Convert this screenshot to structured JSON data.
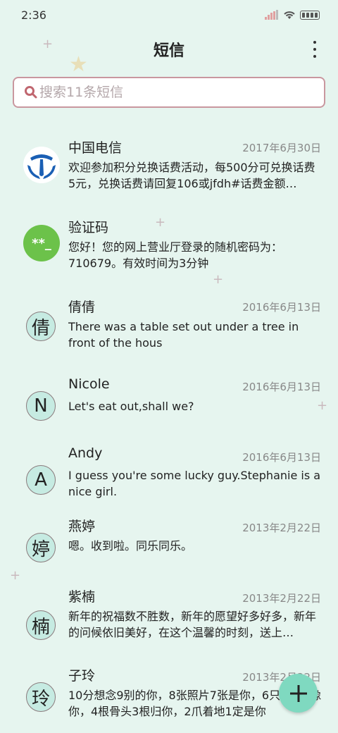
{
  "status": {
    "time": "2:36"
  },
  "header": {
    "title": "短信"
  },
  "search": {
    "placeholder": "搜索11条短信"
  },
  "conversations": [
    {
      "avatar_text": "",
      "avatar_type": "china-telecom-logo",
      "name": "中国电信",
      "date": "2017年6月30日",
      "preview": "欢迎参加积分兑换话费活动，每500分可兑换话费5元，兑换话费请回复106或jfdh#话费金额…"
    },
    {
      "avatar_text": "**_",
      "avatar_type": "code",
      "name": "验证码",
      "date": "",
      "preview": "您好！您的网上营业厅登录的随机密码为：710679。有效时间为3分钟"
    },
    {
      "avatar_text": "倩",
      "avatar_type": "letter",
      "name": "倩倩",
      "date": "2016年6月13日",
      "preview": "There was a table set out under a tree in front of the hous"
    },
    {
      "avatar_text": "N",
      "avatar_type": "letter",
      "name": "Nicole",
      "date": "2016年6月13日",
      "preview": "Let's eat out,shall we?"
    },
    {
      "avatar_text": "A",
      "avatar_type": "letter",
      "name": "Andy",
      "date": "2016年6月13日",
      "preview": "I guess you're some lucky guy.Stephanie is a nice girl."
    },
    {
      "avatar_text": "婷",
      "avatar_type": "letter",
      "name": "燕婷",
      "date": "2013年2月22日",
      "preview": "嗯。收到啦。同乐同乐。"
    },
    {
      "avatar_text": "楠",
      "avatar_type": "letter",
      "name": "紫楠",
      "date": "2013年2月22日",
      "preview": "新年的祝福数不胜数，新年的愿望好多好多，新年的问候依旧美好，在这个温馨的时刻，送上…"
    },
    {
      "avatar_text": "玲",
      "avatar_type": "letter",
      "name": "子玲",
      "date": "2013年2月22日",
      "preview": "10分想念9别的你，8张照片7张是你，6只猫5只像你，4根骨头3根归你，2爪着地1定是你"
    }
  ],
  "colors": {
    "background": "#e6f5ef",
    "accent": "#7fd9c0",
    "search_border": "#c9979f",
    "avatar_bg": "#c6ebe2"
  },
  "icons": {
    "search": "search-icon",
    "more": "more-vertical-icon",
    "fab": "plus-icon"
  }
}
